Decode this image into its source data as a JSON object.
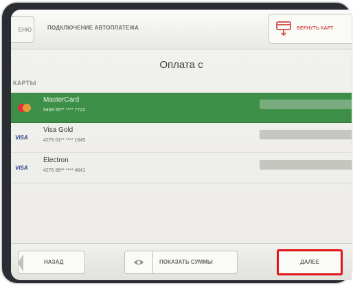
{
  "header": {
    "back_label": "ЕНЮ",
    "title": "ПОДКЛЮЧЕНИЕ АВТОПЛАТЕЖА",
    "return_card_label": "ВЕРНУТЬ КАРТ"
  },
  "main": {
    "heading": "Оплата с",
    "section_label": "КАРТЫ",
    "cards": [
      {
        "name": "MasterCard",
        "number": "5469 55** **** 7722",
        "logo": "mastercard-logo",
        "selected": true
      },
      {
        "name": "Visa Gold",
        "number": "4279 01** **** 1845",
        "logo": "VISA",
        "selected": false
      },
      {
        "name": "Electron",
        "number": "4276 88** **** 4841",
        "logo": "VISA",
        "selected": false
      }
    ]
  },
  "footer": {
    "back_label": "НАЗАД",
    "show_sums_label": "ПОКАЗАТЬ СУММЫ",
    "show_sums_icon": "eye-icon",
    "next_label": "ДАЛЕЕ"
  },
  "colors": {
    "selected_row": "#3d8f47",
    "highlight": "#e01414",
    "return_card": "#d45a5a"
  }
}
